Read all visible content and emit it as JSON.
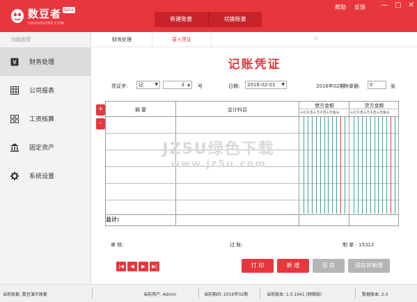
{
  "app": {
    "name": "数豆者",
    "subtitle": "SHUDOUZHE.COM",
    "badge": "beta"
  },
  "header": {
    "buttons": [
      "新建账套",
      "切换账套"
    ],
    "links": [
      "帮助",
      "反馈"
    ],
    "window_controls": [
      "—",
      "□",
      "✕"
    ]
  },
  "sidebar": {
    "title": "功能选项",
    "items": [
      {
        "label": "财务处理",
        "icon": "yen-icon",
        "active": true
      },
      {
        "label": "公司报表",
        "icon": "table-icon",
        "active": false
      },
      {
        "label": "工资核算",
        "icon": "grid-icon",
        "active": false
      },
      {
        "label": "固定资产",
        "icon": "bank-icon",
        "active": false
      },
      {
        "label": "系统设置",
        "icon": "gear-icon",
        "active": false
      }
    ]
  },
  "tabs": [
    "财务处理",
    "录入凭证"
  ],
  "tab_close": "×",
  "voucher": {
    "title": "记账凭证",
    "word_label": "凭证字:",
    "word_value": "记",
    "number_value": "3",
    "number_suffix": "号",
    "date_label": "日期:",
    "date_value": "2016-02-01",
    "period": "2016年02期",
    "attach_label": "附单据:",
    "attach_value": "0",
    "attach_suffix": "张"
  },
  "table": {
    "col_summary": "摘  要",
    "col_account": "会计科目",
    "col_debit": "借方金额",
    "col_credit": "贷方金额",
    "digits": "十亿千百十万千百十元角分",
    "total_label": "总计:"
  },
  "row_buttons": [
    "+",
    "-"
  ],
  "footer": {
    "review_label": "审 核:",
    "post_label": "过 账:",
    "maker_label": "制 单 : 15312"
  },
  "nav_buttons": [
    "|◀",
    "◀",
    "▶",
    "▶|"
  ],
  "actions": {
    "print": "打 印",
    "new": "新 增",
    "save": "保 存",
    "save_new": "保存并新增"
  },
  "watermark": {
    "line1": "JZ5U绿色下载",
    "line2": "www.jz5u.com"
  },
  "status": {
    "book": "当前账套:  数豆演示账套",
    "user": "当前用户: Admin",
    "period": "当前期间:  2016年02期",
    "version": "当前版本: 1.0.1641  (网络版)",
    "data_version": "数据版本: 2.0"
  },
  "colors": {
    "brand": "#e8363d",
    "debit_lines": "#2aa9a0",
    "unit_line": "#e8363d"
  }
}
